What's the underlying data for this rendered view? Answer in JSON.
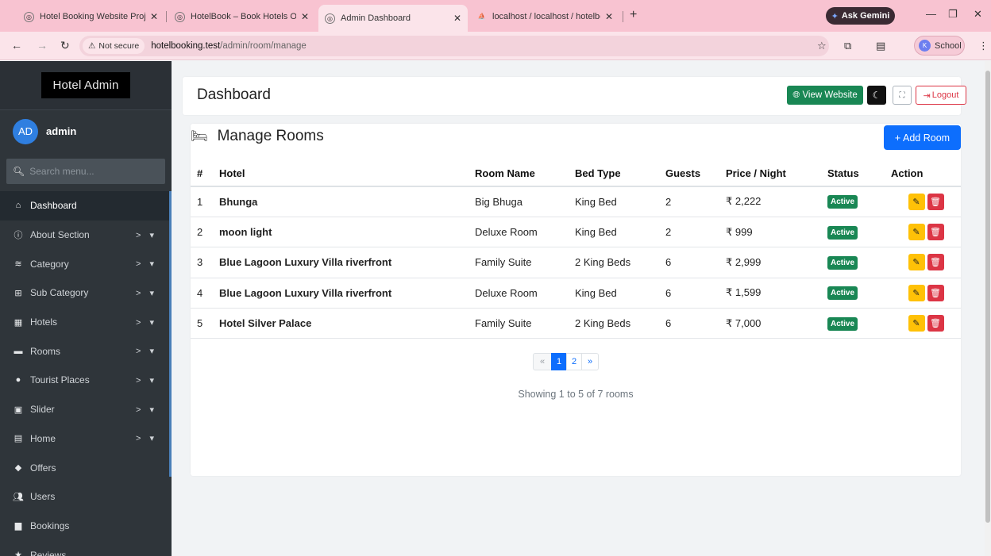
{
  "browser": {
    "tabs": [
      {
        "label": "Hotel Booking Website Project"
      },
      {
        "label": "HotelBook – Book Hotels Onlin"
      },
      {
        "label": "Admin Dashboard"
      },
      {
        "label": "localhost / localhost / hotelboo"
      }
    ],
    "ask_gemini": "Ask Gemini",
    "not_secure": "Not secure",
    "url_host": "hotelbooking.test",
    "url_path": "/admin/room/manage",
    "profile_initial": "K",
    "profile_label": "School"
  },
  "sidebar": {
    "brand": "Hotel Admin",
    "avatar_initials": "AD",
    "username": "admin",
    "search_placeholder": "Search menu...",
    "items": [
      {
        "label": "Dashboard",
        "icon": "home-icon"
      },
      {
        "label": "About Section",
        "icon": "info-icon"
      },
      {
        "label": "Category",
        "icon": "layers-icon"
      },
      {
        "label": "Sub Category",
        "icon": "sitemap-icon"
      },
      {
        "label": "Hotels",
        "icon": "hotel-icon"
      },
      {
        "label": "Rooms",
        "icon": "bed-icon"
      },
      {
        "label": "Tourist Places",
        "icon": "map-pin-icon"
      },
      {
        "label": "Slider",
        "icon": "images-icon"
      },
      {
        "label": "Home",
        "icon": "building-icon"
      },
      {
        "label": "Offers",
        "icon": "tag-icon"
      },
      {
        "label": "Users",
        "icon": "users-icon"
      },
      {
        "label": "Bookings",
        "icon": "book-icon"
      },
      {
        "label": "Reviews",
        "icon": "star-icon"
      }
    ]
  },
  "header": {
    "title": "Dashboard",
    "view_website": "View Website",
    "logout": "Logout"
  },
  "rooms": {
    "title": "Manage Rooms",
    "add_button": "+ Add Room",
    "columns": [
      "#",
      "Hotel",
      "Room Name",
      "Bed Type",
      "Guests",
      "Price / Night",
      "Status",
      "Action"
    ],
    "rows": [
      {
        "num": "1",
        "hotel": "Bhunga",
        "room": "Big Bhuga",
        "bed": "King Bed",
        "guests": "2",
        "price": "₹ 2,222",
        "status": "Active"
      },
      {
        "num": "2",
        "hotel": "moon light",
        "room": "Deluxe Room",
        "bed": "King Bed",
        "guests": "2",
        "price": "₹ 999",
        "status": "Active"
      },
      {
        "num": "3",
        "hotel": "Blue Lagoon Luxury Villa riverfront",
        "room": "Family Suite",
        "bed": "2 King Beds",
        "guests": "6",
        "price": "₹ 2,999",
        "status": "Active"
      },
      {
        "num": "4",
        "hotel": "Blue Lagoon Luxury Villa riverfront",
        "room": "Deluxe Room",
        "bed": "King Bed",
        "guests": "6",
        "price": "₹ 1,599",
        "status": "Active"
      },
      {
        "num": "5",
        "hotel": "Hotel Silver Palace",
        "room": "Family Suite",
        "bed": "2 King Beds",
        "guests": "6",
        "price": "₹ 7,000",
        "status": "Active"
      }
    ],
    "pagination": {
      "prev": "«",
      "pages": [
        "1",
        "2"
      ],
      "current": "1",
      "next": "»"
    },
    "showing": "Showing 1 to 5 of 7 rooms"
  },
  "colors": {
    "accent": "#0d6efd",
    "success": "#198754",
    "danger": "#dc3545",
    "warning": "#ffc107",
    "sidebar_bg": "#2f353a"
  }
}
